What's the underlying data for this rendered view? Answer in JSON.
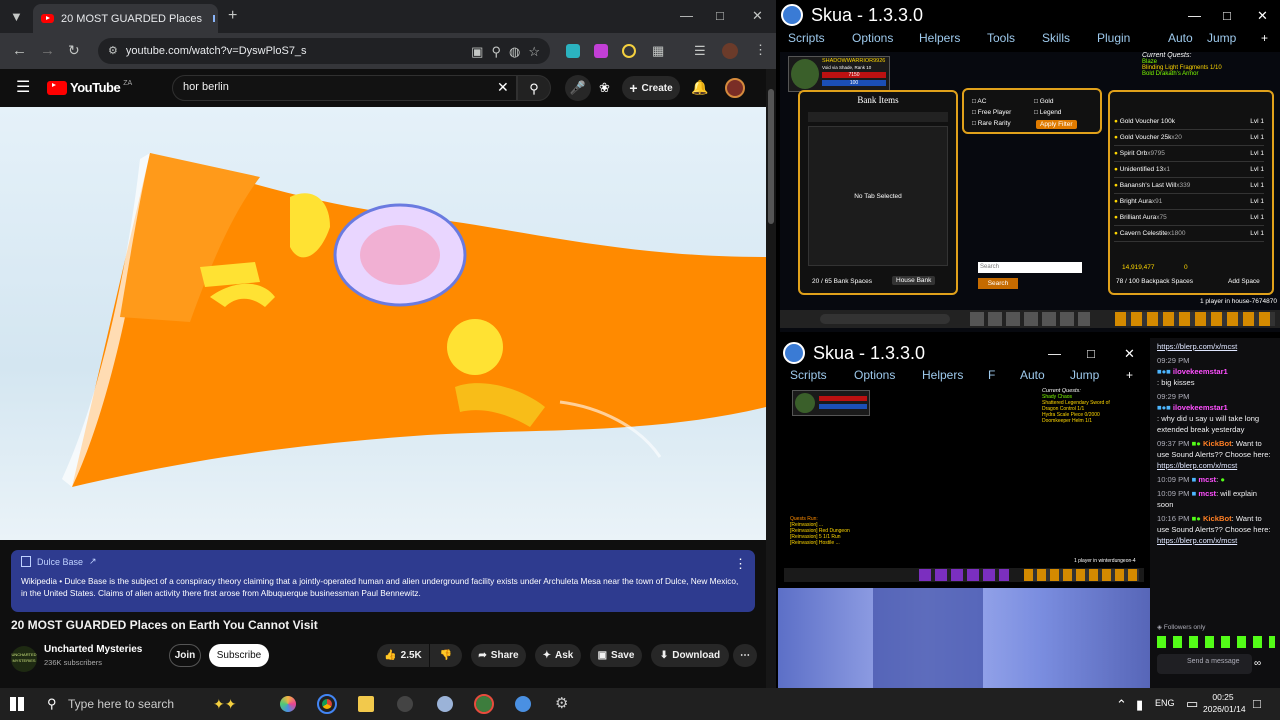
{
  "browser": {
    "tab_title": "20 MOST GUARDED Places",
    "url": "youtube.com/watch?v=DyswPloS7_s"
  },
  "youtube": {
    "logo_text": "YouTube",
    "logo_sup": "ZA",
    "search_value": "hor berlin",
    "create_label": "Create",
    "info_card": {
      "title": "Dulce Base",
      "text": "Wikipedia • Dulce Base is the subject of a conspiracy theory claiming that a jointly-operated human and alien underground facility exists under Archuleta Mesa near the town of Dulce, New Mexico, in the United States. Claims of alien activity there first arose from Albuquerque businessman Paul Bennewitz."
    },
    "video_title": "20 MOST GUARDED Places on Earth You Cannot Visit",
    "channel": {
      "name": "Uncharted Mysteries",
      "subscribers": "236K subscribers",
      "avatar_text": "UNCHARTED MYSTERIES"
    },
    "join_label": "Join",
    "subscribe_label": "Subscribe",
    "likes": "2.5K",
    "share_label": "Share",
    "ask_label": "Ask",
    "save_label": "Save",
    "download_label": "Download"
  },
  "skua1": {
    "title": "Skua - 1.3.3.0",
    "menu": [
      "Scripts",
      "Options",
      "Helpers",
      "Tools",
      "Skills",
      "Plugin",
      "Auto",
      "Jump"
    ],
    "player_name": "SHADOWWARRIOR9926",
    "player_class": "Void via Shade, Rank 10",
    "hp": "7150",
    "mp": "100",
    "quests_title": "Current Quests:",
    "quest_group": "Blaze",
    "quests": [
      "Blinding Light Fragments 1/10",
      "Bold Drakath's Armor",
      "Blade of Awe 1/1"
    ],
    "bank_title": "Bank Items",
    "bank_empty": "No Tab Selected",
    "bank_spaces": "20 / 65 Bank Spaces",
    "house_bank": "House Bank",
    "filters": [
      "AC",
      "Gold",
      "Free Player",
      "Legend",
      "Rare Rarity"
    ],
    "apply_filter": "Apply Filter",
    "search_placeholder": "Search",
    "search_btn": "Search",
    "items": [
      {
        "name": "Gold Voucher 100k",
        "qty": "",
        "lvl": "Lvl 1"
      },
      {
        "name": "Gold Voucher 25k",
        "qty": "x20",
        "lvl": "Lvl 1"
      },
      {
        "name": "Spirit Orb",
        "qty": "x9795",
        "lvl": "Lvl 1"
      },
      {
        "name": "Unidentified 13",
        "qty": "x1",
        "lvl": "Lvl 1"
      },
      {
        "name": "Banansh's Last Will",
        "qty": "x339",
        "lvl": "Lvl 1"
      },
      {
        "name": "Bright Aura",
        "qty": "x91",
        "lvl": "Lvl 1"
      },
      {
        "name": "Brilliant Aura",
        "qty": "x75",
        "lvl": "Lvl 1"
      },
      {
        "name": "Cavern Celestite",
        "qty": "x1800",
        "lvl": "Lvl 1"
      }
    ],
    "gold": "14,919,477",
    "acs": "0",
    "backpack": "78 / 100 Backpack Spaces",
    "add_space": "Add Space",
    "players": "1 player in house-7674870"
  },
  "skua2": {
    "title": "Skua - 1.3.3.0",
    "menu": [
      "Scripts",
      "Options",
      "Helpers",
      "F",
      "Auto",
      "Jump"
    ],
    "quests_title": "Current Quests:",
    "quest_group": "Shady Chaos",
    "quests": [
      "Shattered Legendary Sword of",
      "Dragon Control 1/1",
      "Hydra Scale Piece 0/2000",
      "Doomkeeper Helm 1/1"
    ],
    "log": [
      "Quests Run:",
      "[Reinvasion] ...",
      "[Reinvasion] Red Dungeon",
      "[Reinvasion] 5 1/1 Run",
      "[Reinvasion] Hostile ..."
    ],
    "players": "1 player in winterdungeon-4"
  },
  "chat": {
    "link": "https://blerp.com/x/mcst",
    "messages": [
      {
        "time": "09:29 PM",
        "user": "ilovekeemstar1",
        "text": ": big kisses"
      },
      {
        "time": "09:29 PM",
        "user": "ilovekeemstar1",
        "text": ": why did u say u will take long extended break yesterday"
      },
      {
        "time": "09:37 PM",
        "user": "KickBot",
        "text": ": Want to use Sound Alerts?? Choose here:",
        "link": "https://blerp.com/x/mcst"
      },
      {
        "time": "10:09 PM",
        "user": "mcst",
        "text": ":"
      },
      {
        "time": "10:09 PM",
        "user": "mcst",
        "text": ": will explain soon"
      },
      {
        "time": "10:16 PM",
        "user": "KickBot",
        "text": ": Want to use Sound Alerts?? Choose here:",
        "link": "https://blerp.com/x/mcst"
      }
    ],
    "mode": "Followers only",
    "input_placeholder": "Send a message"
  },
  "taskbar": {
    "search_placeholder": "Type here to search",
    "lang": "ENG",
    "time": "00:25",
    "date": "2026/01/14"
  }
}
